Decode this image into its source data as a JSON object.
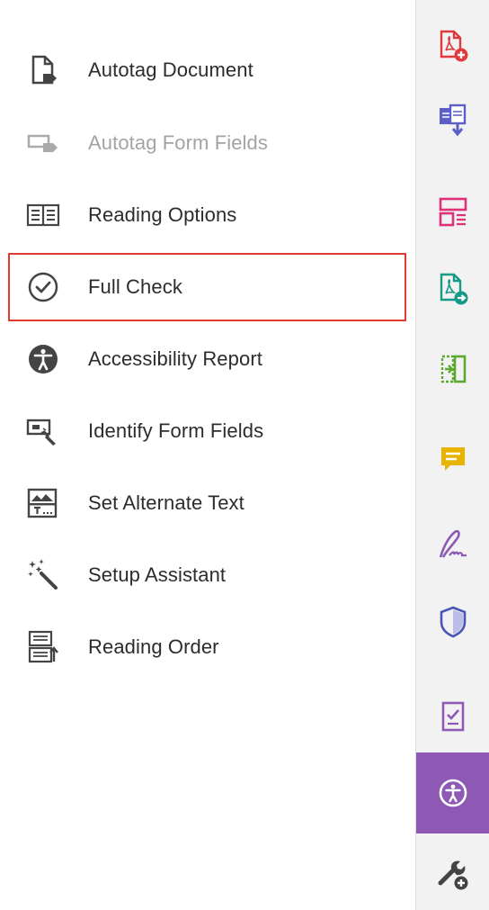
{
  "panel": {
    "items": [
      {
        "label": "Autotag Document",
        "icon": "autotag-document-icon",
        "enabled": true,
        "selected": false
      },
      {
        "label": "Autotag Form Fields",
        "icon": "autotag-form-fields-icon",
        "enabled": false,
        "selected": false
      },
      {
        "label": "Reading Options",
        "icon": "reading-options-icon",
        "enabled": true,
        "selected": false
      },
      {
        "label": "Full Check",
        "icon": "full-check-icon",
        "enabled": true,
        "selected": true
      },
      {
        "label": "Accessibility Report",
        "icon": "accessibility-report-icon",
        "enabled": true,
        "selected": false
      },
      {
        "label": "Identify Form Fields",
        "icon": "identify-form-fields-icon",
        "enabled": true,
        "selected": false
      },
      {
        "label": "Set Alternate Text",
        "icon": "set-alternate-text-icon",
        "enabled": true,
        "selected": false
      },
      {
        "label": "Setup Assistant",
        "icon": "setup-assistant-icon",
        "enabled": true,
        "selected": false
      },
      {
        "label": "Reading Order",
        "icon": "reading-order-icon",
        "enabled": true,
        "selected": false
      }
    ]
  },
  "rail": {
    "tools": [
      {
        "icon": "create-pdf-icon",
        "color": "#e03a3e",
        "active": false
      },
      {
        "icon": "combine-files-icon",
        "color": "#5b5fc7",
        "active": false
      },
      {
        "icon": "organize-pages-icon",
        "color": "#e0307a",
        "active": false
      },
      {
        "icon": "export-pdf-icon",
        "color": "#159a87",
        "active": false
      },
      {
        "icon": "compress-pdf-icon",
        "color": "#5ca92f",
        "active": false
      },
      {
        "icon": "comment-icon",
        "color": "#e8b400",
        "active": false
      },
      {
        "icon": "fill-sign-icon",
        "color": "#8d59b5",
        "active": false
      },
      {
        "icon": "protect-icon",
        "color": "#4b55b8",
        "active": false
      },
      {
        "icon": "request-signatures-icon",
        "color": "#8d59b5",
        "active": false
      },
      {
        "icon": "accessibility-icon",
        "color": "#8d59b5",
        "active": true
      },
      {
        "icon": "more-tools-icon",
        "color": "#444444",
        "active": false
      }
    ]
  }
}
